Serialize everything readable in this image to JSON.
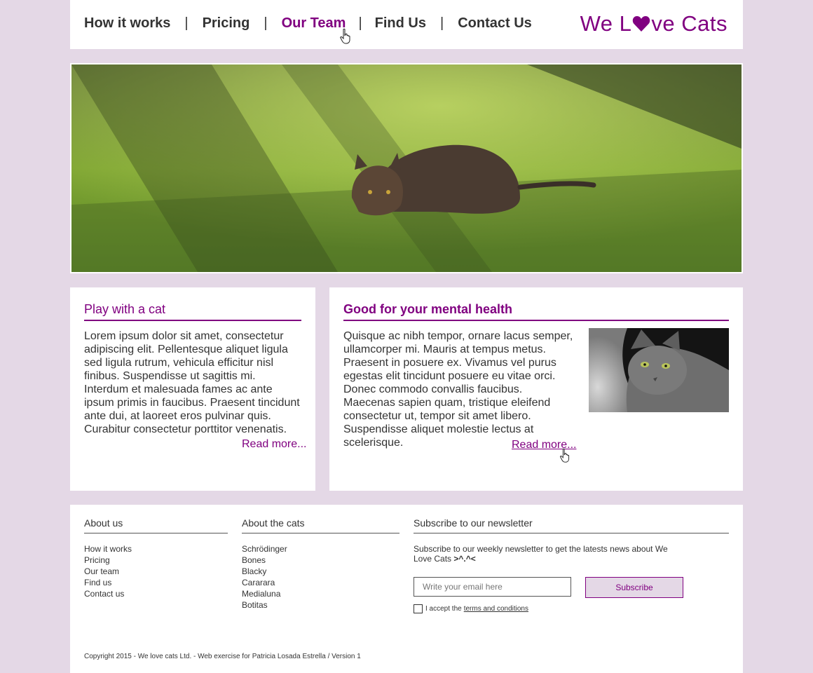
{
  "nav": {
    "items": [
      "How it works",
      "Pricing",
      "Our Team",
      "Find Us",
      "Contact Us"
    ],
    "separator": "|",
    "active": "Our Team"
  },
  "logo": {
    "part1": "We L",
    "part2": "ve Cats",
    "heart_icon": "heart-icon",
    "color": "#800080"
  },
  "hero": {
    "image": "cat-in-grass-photo"
  },
  "panel_left": {
    "title": "Play with a cat",
    "body": "Lorem ipsum dolor sit amet, consectetur adipiscing elit. Pellentesque aliquet ligula sed ligula rutrum, vehicula efficitur nisl finibus. Suspendisse ut sagittis mi. Interdum et malesuada fames ac ante ipsum primis in faucibus. Praesent tincidunt ante dui, at laoreet eros pulvinar quis. Curabitur consectetur porttitor venenatis.",
    "more": "Read more..."
  },
  "panel_right": {
    "title": "Good for your mental health",
    "body": "Quisque ac nibh tempor, ornare lacus semper, ullamcorper mi. Mauris at tempus metus. Praesent in posuere ex. Vivamus vel purus egestas elit tincidunt posuere eu vitae orci. Donec commodo convallis faucibus. Maecenas sapien quam, tristique eleifend consectetur ut, tempor sit amet libero. Suspendisse aliquet molestie lectus at scelerisque.",
    "more": "Read more...",
    "image": "grey-cat-photo"
  },
  "footer": {
    "about_us": {
      "title": "About us",
      "links": [
        "How it works",
        "Pricing",
        "Our team",
        "Find us",
        "Contact us"
      ]
    },
    "about_cats": {
      "title": "About the cats",
      "links": [
        "Schrödinger",
        "Bones",
        "Blacky",
        "Cararara",
        "Medialuna",
        "Botitas"
      ]
    },
    "newsletter": {
      "title": "Subscribe to our newsletter",
      "text": "Subscribe to our weekly newsletter to get the latests news about We Love Cats",
      "emoticon": ">^.^<",
      "email_placeholder": "Write your email here",
      "button": "Subscribe",
      "accept": "I accept the",
      "terms": "terms and conditions"
    },
    "copyright": "Copyright 2015 - We love cats Ltd. - Web exercise for Patricia Losada Estrella / Version 1"
  },
  "colors": {
    "accent": "#800080",
    "background": "#e4d8e6"
  }
}
